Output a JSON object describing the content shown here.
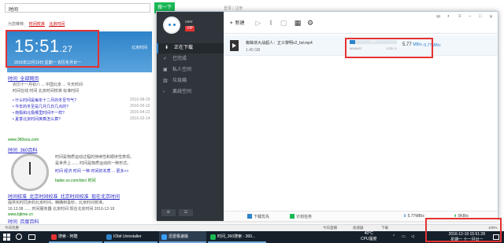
{
  "browser": {
    "search_query": "时间",
    "search_button": "搜一下",
    "login_text": "登录 | 注册",
    "related_label": "为您推荐:",
    "related_links": [
      "时间校准",
      "北京时间"
    ],
    "clock_widget": {
      "time": "15:51",
      "seconds": "27",
      "date_line": "2016年12月19日 星期一 农历冬月廿一",
      "right_text": "北京时间"
    },
    "results": [
      {
        "title": "时间_全部网页",
        "lines": [
          "农历十一月初八 ... 中国北京 ... 今天时间",
          "时间在线 时间 北京时间校准 标准时间",
          "• 什么时间是每年十二月的冬至节气?",
          "• 今年的冬至是几月几日几点的?",
          "• 南极和北极哪里时间不一样?",
          "• 夏季北京时间换算怎么算?"
        ],
        "dates": [
          "2016-08-29",
          "2016-05-16",
          "2016-04-22",
          "2016-03-14"
        ],
        "url": "www.360sou.com"
      },
      {
        "title": "时间_360百科",
        "lines": [
          "时间是物质运动过程的持续性和顺序性表现。",
          "是世界上 ...... 时间是物质运动的一种形式。",
          "时间 经济 时间 一种 时间的本质 ... 更多>>",
          "baike.so.com/doc/ 时间"
        ],
        "url": "baike.so.com"
      },
      {
        "title": "时间校准_北京时间校准_北京时间校准_现在北京时间",
        "lines": [
          "提供实时同步的北京时间，精确到毫秒，北京时间校准。",
          "16:13:38 ...... 时间服务器 北京时间 现在北京时间 2016-12-19"
        ],
        "url": "www.bjtime.cn"
      },
      {
        "title": "时间_百度百科",
        "lines": [],
        "url": ""
      }
    ],
    "status_left": "今日优惠",
    "status_items": [
      "今日直播",
      "加速器",
      "下载",
      "100%"
    ]
  },
  "download_manager": {
    "username": "user",
    "vip": "VIP",
    "nav": [
      {
        "label": "正在下载",
        "icon": "download-icon",
        "active": true
      },
      {
        "label": "已完成",
        "icon": "check-icon",
        "active": false
      },
      {
        "label": "私人空间",
        "icon": "lock-icon",
        "active": false
      },
      {
        "label": "垃圾箱",
        "icon": "trash-icon",
        "active": false
      },
      {
        "label": "离线空间",
        "icon": "cloud-icon",
        "active": false
      }
    ],
    "toolbar": {
      "new_label": "新建"
    },
    "task": {
      "name": "蜘蛛侠大战超人：正义黎明v2_bd.mp4",
      "size": "1.45 GB",
      "progress_pct": 12,
      "progress_text": "12%",
      "elapsed": "00:00:07",
      "remaining": "1.23 / 1",
      "speed": "5.77",
      "speed_unit": "MB/s",
      "up_speed": "↑5.77MB/s"
    },
    "status": {
      "feature1": "下载优先",
      "feature2": "计划任务",
      "down_speed": "5.77MB/s",
      "up_speed": "0KB/s"
    }
  },
  "taskbar": {
    "apps": [
      {
        "label": "搜索 - 阿酷",
        "active": false
      },
      {
        "label": "IObit Uninstaller",
        "active": false
      },
      {
        "label": "迅雷极速版",
        "active": true
      },
      {
        "label": "时间_360搜索 - 360...",
        "active": false
      }
    ],
    "tray_temp": "40°C",
    "tray_temp_label": "CPU温度",
    "clock_time": "2016-12-19 15:51:28",
    "clock_date": "星期一 十一月廿一",
    "accent": "#6fa8dc"
  },
  "colors": {
    "search_green": "#19b955",
    "highlight_red": "#e53232",
    "link_blue": "#2828c8",
    "dm_sidebar": "#2f353b",
    "progress_blue": "#2e83c9"
  }
}
